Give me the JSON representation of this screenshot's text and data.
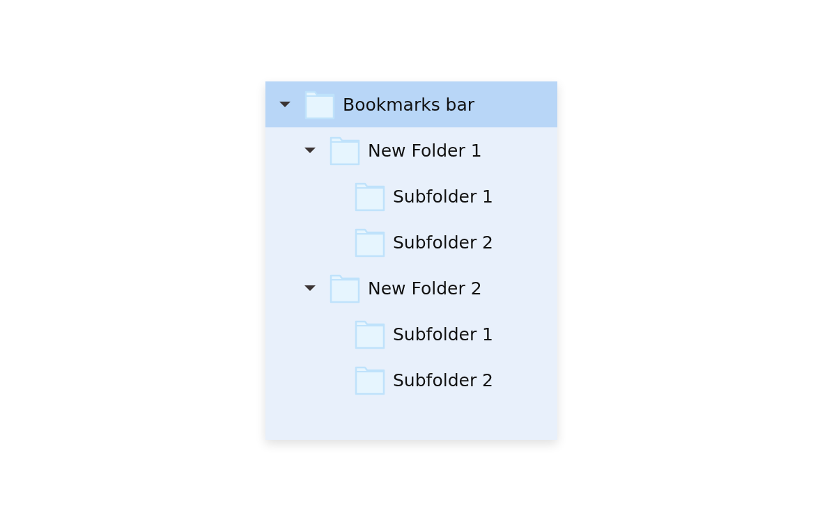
{
  "tree": [
    {
      "label": "Bookmarks bar",
      "selected": true,
      "expanded": true,
      "children": [
        {
          "label": "New Folder 1",
          "selected": false,
          "expanded": true,
          "children": [
            {
              "label": "Subfolder 1",
              "selected": false
            },
            {
              "label": "Subfolder 2",
              "selected": false
            }
          ]
        },
        {
          "label": "New Folder 2",
          "selected": false,
          "expanded": true,
          "children": [
            {
              "label": "Subfolder 1",
              "selected": false
            },
            {
              "label": "Subfolder 2",
              "selected": false
            }
          ]
        }
      ]
    }
  ]
}
